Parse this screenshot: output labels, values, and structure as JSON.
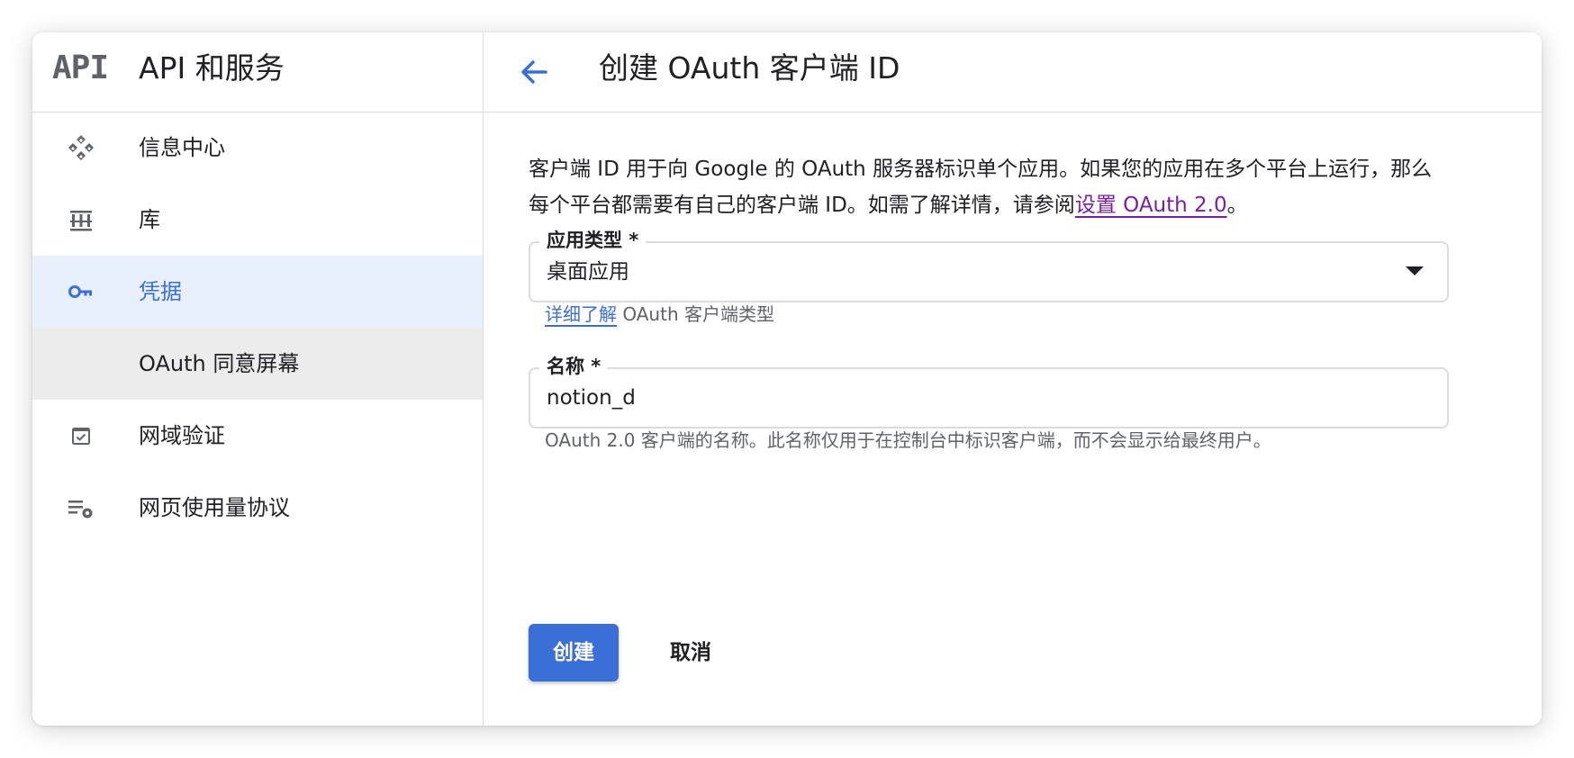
{
  "sidebar": {
    "logo": "API",
    "title": "API 和服务",
    "items": [
      {
        "label": "信息中心",
        "icon": "dashboard-icon"
      },
      {
        "label": "库",
        "icon": "library-icon"
      },
      {
        "label": "凭据",
        "icon": "key-icon",
        "active": true
      },
      {
        "label": "OAuth 同意屏幕",
        "icon": "",
        "sub": true
      },
      {
        "label": "网域验证",
        "icon": "checkbox-icon"
      },
      {
        "label": "网页使用量协议",
        "icon": "list-settings-icon"
      }
    ]
  },
  "header": {
    "back_icon": "arrow-back-icon",
    "title": "创建 OAuth 客户端 ID"
  },
  "description": {
    "text": "客户端 ID 用于向 Google 的 OAuth 服务器标识单个应用。如果您的应用在多个平台上运行，那么每个平台都需要有自己的客户端 ID。如需了解详情，请参阅",
    "link": "设置 OAuth 2.0",
    "suffix": "。"
  },
  "app_type": {
    "label": "应用类型 *",
    "value": "桌面应用",
    "helper_link": "详细了解",
    "helper_text": " OAuth 客户端类型"
  },
  "name": {
    "label": "名称 *",
    "value": "notion_d",
    "helper_text": "OAuth 2.0 客户端的名称。此名称仅用于在控制台中标识客户端，而不会显示给最终用户。"
  },
  "actions": {
    "create": "创建",
    "cancel": "取消"
  },
  "colors": {
    "accent": "#3b6fd8",
    "active_bg": "#e8f0fe",
    "link_visited": "#7b1fa2"
  }
}
